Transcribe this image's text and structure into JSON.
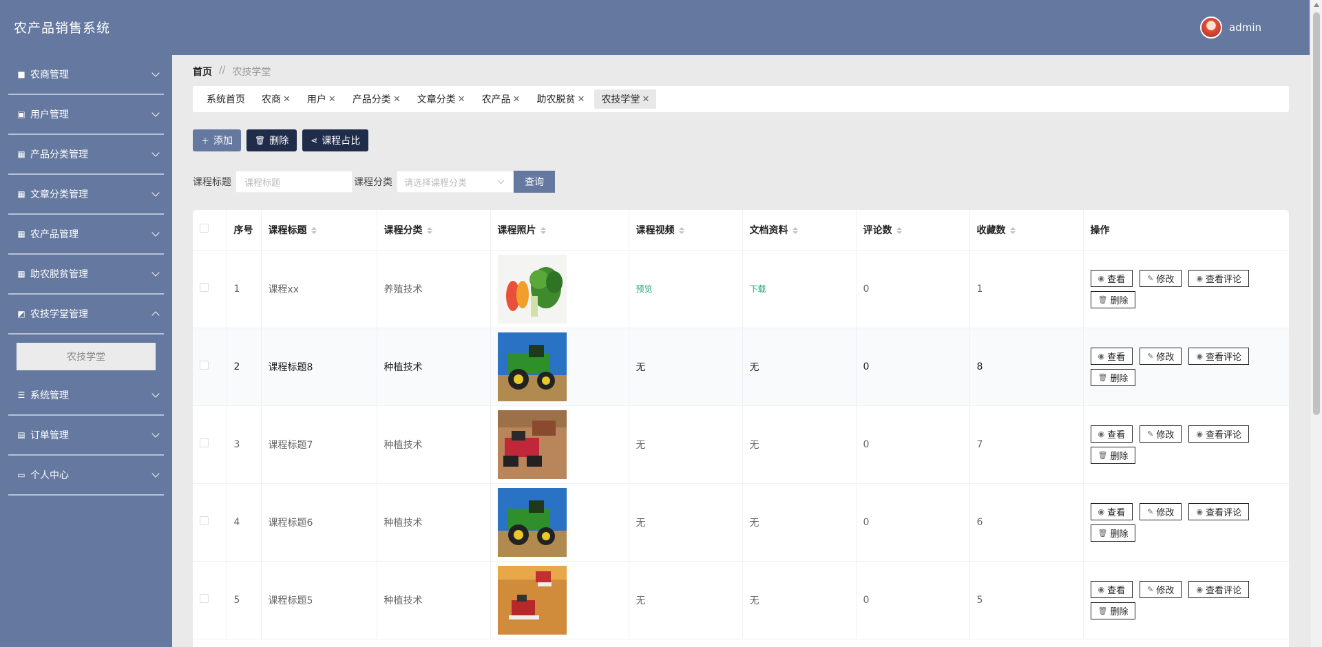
{
  "app": {
    "title": "农产品销售系统",
    "user": "admin"
  },
  "sidebar": {
    "items": [
      {
        "label": "农商管理",
        "icon": "briefcase-icon",
        "expanded": false
      },
      {
        "label": "用户管理",
        "icon": "user-file-icon",
        "expanded": false
      },
      {
        "label": "产品分类管理",
        "icon": "grid-icon",
        "expanded": false
      },
      {
        "label": "文章分类管理",
        "icon": "grid-icon",
        "expanded": false
      },
      {
        "label": "农产品管理",
        "icon": "grid-icon",
        "expanded": false
      },
      {
        "label": "助农脱贫管理",
        "icon": "grid-icon",
        "expanded": false
      },
      {
        "label": "农技学堂管理",
        "icon": "chart-icon",
        "expanded": true
      },
      {
        "label": "系统管理",
        "icon": "sliders-icon",
        "expanded": false
      },
      {
        "label": "订单管理",
        "icon": "clipboard-icon",
        "expanded": false
      },
      {
        "label": "个人中心",
        "icon": "card-icon",
        "expanded": false
      }
    ],
    "submenu": {
      "label": "农技学堂"
    }
  },
  "breadcrumb": {
    "home": "首页",
    "sep": "//",
    "current": "农技学堂"
  },
  "tabs": [
    {
      "label": "系统首页",
      "closable": false
    },
    {
      "label": "农商",
      "closable": true
    },
    {
      "label": "用户",
      "closable": true
    },
    {
      "label": "产品分类",
      "closable": true
    },
    {
      "label": "文章分类",
      "closable": true
    },
    {
      "label": "农产品",
      "closable": true
    },
    {
      "label": "助农脱贫",
      "closable": true
    },
    {
      "label": "农技学堂",
      "closable": true,
      "active": true
    }
  ],
  "toolbar": {
    "add": "添加",
    "delete": "删除",
    "ratio": "课程占比"
  },
  "search": {
    "title_label": "课程标题",
    "title_placeholder": "课程标题",
    "category_label": "课程分类",
    "category_placeholder": "请选择课程分类",
    "query": "查询"
  },
  "table": {
    "headers": [
      "序号",
      "课程标题",
      "课程分类",
      "课程照片",
      "课程视频",
      "文档资料",
      "评论数",
      "收藏数",
      "操作"
    ],
    "ops": {
      "view": "查看",
      "edit": "修改",
      "comments": "查看评论",
      "delete": "删除"
    },
    "rows": [
      {
        "no": "1",
        "title": "课程xx",
        "category": "养殖技术",
        "photo": "vegetables",
        "video": "预览",
        "doc": "下载",
        "comments": "0",
        "favorites": "1"
      },
      {
        "no": "2",
        "title": "课程标题8",
        "category": "种植技术",
        "photo": "green-tractor",
        "video": "无",
        "doc": "无",
        "comments": "0",
        "favorites": "8"
      },
      {
        "no": "3",
        "title": "课程标题7",
        "category": "种植技术",
        "photo": "red-tractor",
        "video": "无",
        "doc": "无",
        "comments": "0",
        "favorites": "7"
      },
      {
        "no": "4",
        "title": "课程标题6",
        "category": "种植技术",
        "photo": "green-tractor",
        "video": "无",
        "doc": "无",
        "comments": "0",
        "favorites": "6"
      },
      {
        "no": "5",
        "title": "课程标题5",
        "category": "种植技术",
        "photo": "harvesters",
        "video": "无",
        "doc": "无",
        "comments": "0",
        "favorites": "5"
      }
    ]
  }
}
